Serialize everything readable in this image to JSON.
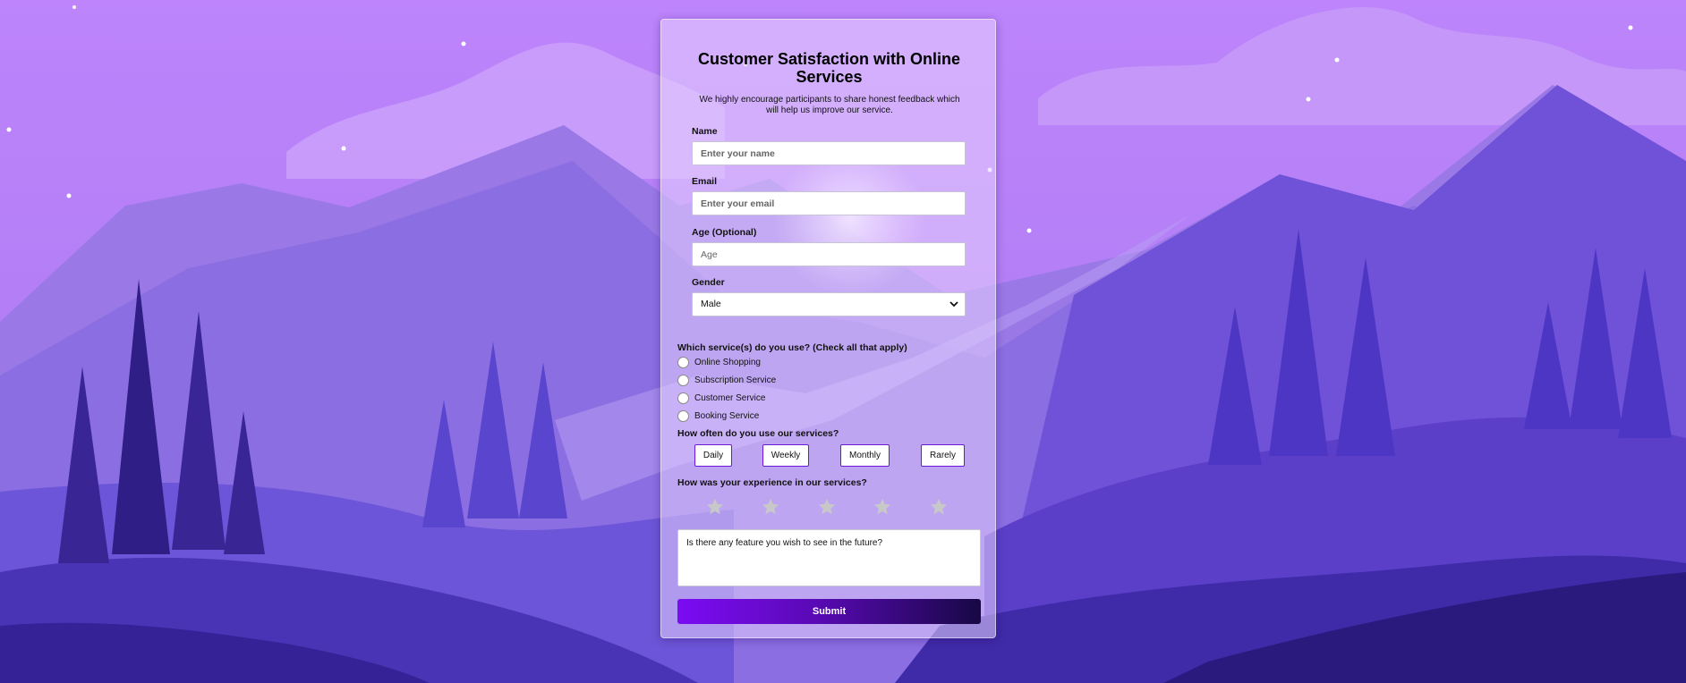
{
  "form": {
    "title": "Customer Satisfaction with Online Services",
    "subtitle": "We highly encourage participants to share honest feedback which will help us improve our service.",
    "name_label": "Name",
    "name_placeholder": "Enter your name",
    "email_label": "Email",
    "email_placeholder": "Enter your email",
    "age_label": "Age (Optional)",
    "age_placeholder": "Age",
    "gender_label": "Gender",
    "gender_selected": "Male",
    "services_question": "Which service(s) do you use? (Check all that apply)",
    "services": [
      "Online Shopping",
      "Subscription Service",
      "Customer Service",
      "Booking Service"
    ],
    "frequency_question": "How often do you use our services?",
    "frequency_options": [
      "Daily",
      "Weekly",
      "Monthly",
      "Rarely"
    ],
    "experience_question": "How was your experience in our services?",
    "rating": {
      "max": 5,
      "selected": 0
    },
    "feature_placeholder": "Is there any feature you wish to see in the future?",
    "submit_label": "Submit"
  },
  "icons": {
    "gender_dropdown": "chevron-down-icon",
    "rating": "star-icon"
  },
  "colors": {
    "accent": "#7c0bf4",
    "button_border": "#6d18d6",
    "star_empty": "#c8c8c8"
  }
}
